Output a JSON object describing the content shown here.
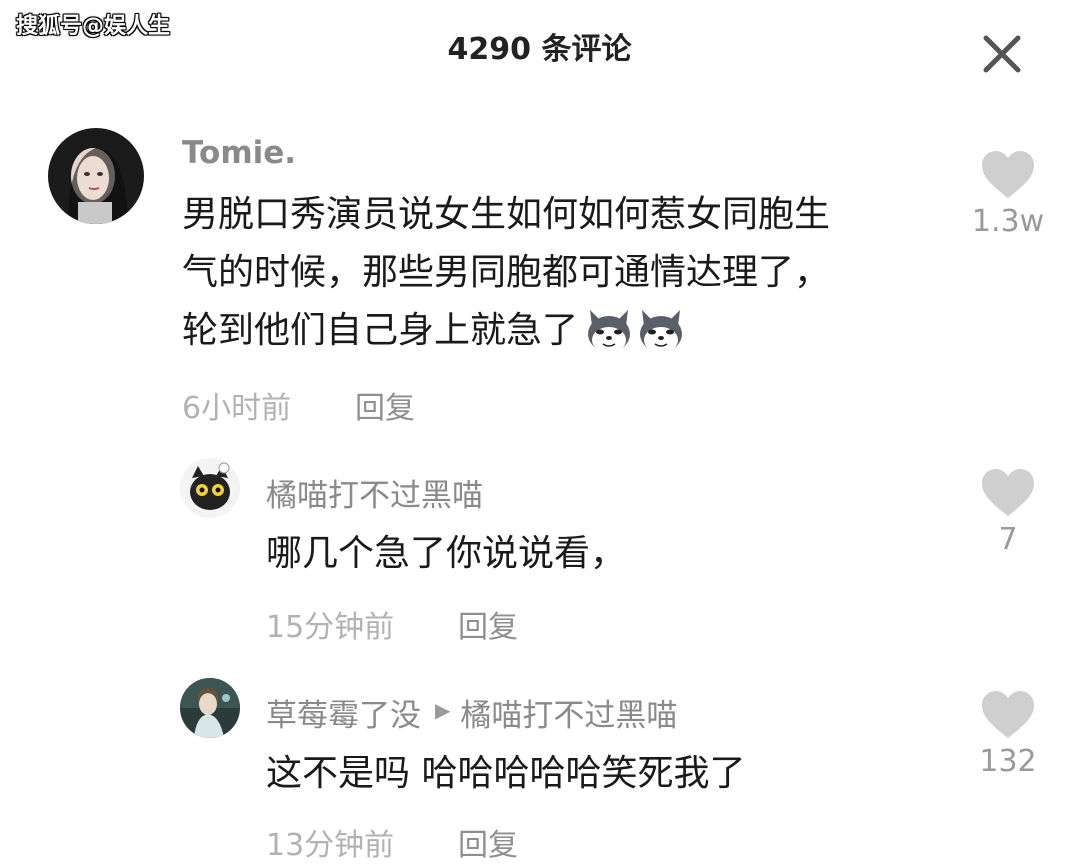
{
  "watermark": "搜狐号@娱人生",
  "header": {
    "title": "4290 条评论"
  },
  "comments": [
    {
      "username": "Tomie.",
      "content_lines": [
        "男脱口秀演员说女生如何如何惹女同胞生",
        "气的时候，那些男同胞都可通情达理了，",
        "轮到他们自己身上就急了"
      ],
      "emoji": "wolf-face-emoji",
      "time": "6小时前",
      "reply_label": "回复",
      "likes": "1.3w"
    },
    {
      "username": "橘喵打不过黑喵",
      "content": "哪几个急了你说说看，",
      "time": "15分钟前",
      "reply_label": "回复",
      "likes": "7"
    },
    {
      "username": "草莓霉了没",
      "reply_to": "橘喵打不过黑喵",
      "content": "这不是吗 哈哈哈哈哈笑死我了",
      "time": "13分钟前",
      "reply_label": "回复",
      "likes": "132"
    }
  ],
  "colors": {
    "text": "#1a1a1a",
    "username": "#8a8a8a",
    "meta": "#b2b2b2",
    "like_icon": "#cfcfcf"
  }
}
